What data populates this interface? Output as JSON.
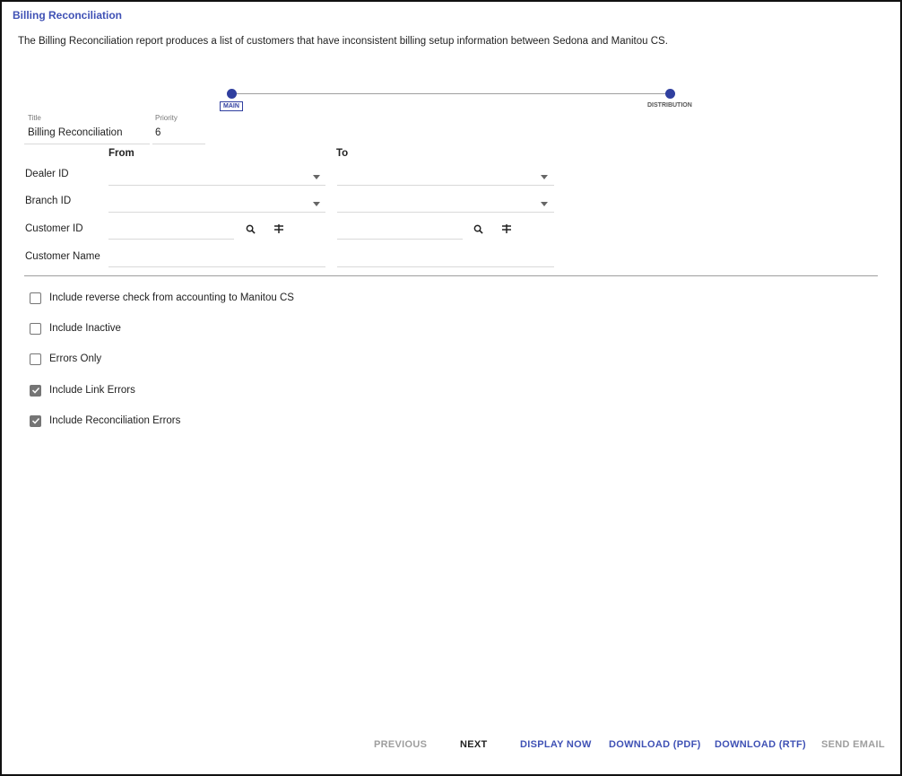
{
  "header": {
    "title": "Billing Reconciliation",
    "description": "The Billing Reconciliation report produces a list of customers that have inconsistent billing setup information between Sedona and Manitou CS."
  },
  "stepper": {
    "steps": [
      {
        "label": "MAIN",
        "active": true
      },
      {
        "label": "DISTRIBUTION",
        "active": false
      }
    ]
  },
  "fields": {
    "title_label": "Title",
    "title_value": "Billing Reconciliation",
    "priority_label": "Priority",
    "priority_value": "6"
  },
  "range": {
    "from_label": "From",
    "to_label": "To",
    "rows": [
      {
        "label": "Dealer ID",
        "type": "select"
      },
      {
        "label": "Branch ID",
        "type": "select"
      },
      {
        "label": "Customer ID",
        "type": "lookup"
      },
      {
        "label": "Customer Name",
        "type": "text"
      }
    ]
  },
  "options": [
    {
      "label": "Include reverse check from accounting to Manitou CS",
      "checked": false
    },
    {
      "label": "Include Inactive",
      "checked": false
    },
    {
      "label": "Errors Only",
      "checked": false
    },
    {
      "label": "Include Link Errors",
      "checked": true
    },
    {
      "label": "Include Reconciliation Errors",
      "checked": true
    }
  ],
  "footer": {
    "previous": "PREVIOUS",
    "next": "NEXT",
    "display_now": "DISPLAY NOW",
    "download_pdf": "DOWNLOAD (PDF)",
    "download_rtf": "DOWNLOAD (RTF)",
    "send_email": "SEND EMAIL"
  },
  "colors": {
    "accent": "#3f51b5",
    "stepper": "#303f9f",
    "disabled": "#9e9e9e",
    "checkbox": "#757575"
  }
}
